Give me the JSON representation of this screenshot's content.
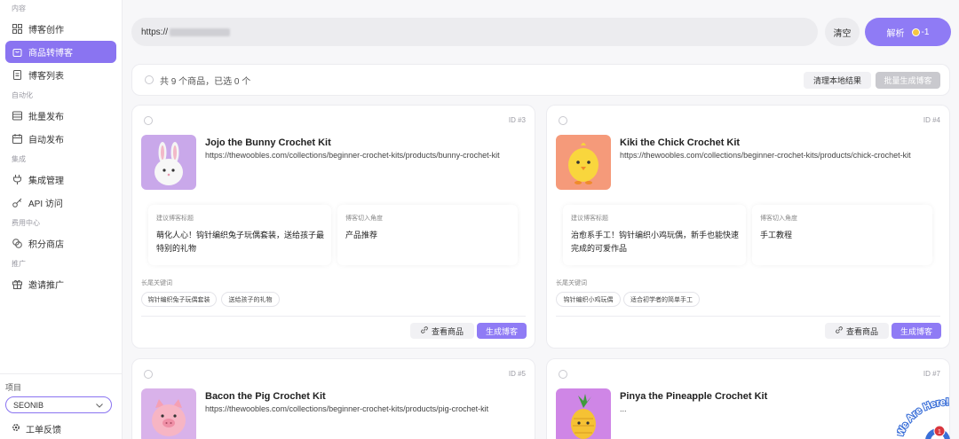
{
  "sidebar": {
    "sections": [
      {
        "label": "内容",
        "items": [
          {
            "label": "博客创作",
            "icon": "grid-icon",
            "active": false
          },
          {
            "label": "商品转博客",
            "icon": "bag-icon",
            "active": true
          },
          {
            "label": "博客列表",
            "icon": "doc-icon",
            "active": false
          }
        ]
      },
      {
        "label": "自动化",
        "items": [
          {
            "label": "批量发布",
            "icon": "stack-icon",
            "active": false
          },
          {
            "label": "自动发布",
            "icon": "calendar-icon",
            "active": false
          }
        ]
      },
      {
        "label": "集成",
        "items": [
          {
            "label": "集成管理",
            "icon": "plug-icon",
            "active": false
          },
          {
            "label": "API 访问",
            "icon": "key-icon",
            "active": false
          }
        ]
      },
      {
        "label": "费用中心",
        "items": [
          {
            "label": "积分商店",
            "icon": "coins-icon",
            "active": false
          }
        ]
      },
      {
        "label": "推广",
        "items": [
          {
            "label": "邀请推广",
            "icon": "gift-icon",
            "active": false
          }
        ]
      }
    ],
    "project_label": "项目",
    "project_value": "SEONIB",
    "feedback_label": "工单反馈"
  },
  "toolbar": {
    "url_prefix": "https://",
    "clear_label": "清空",
    "parse_label": "解析",
    "parse_cost": "-1"
  },
  "status": {
    "text": "共 9 个商品，已选 0 个",
    "clean_label": "清理本地结果",
    "batch_label": "批量生成博客"
  },
  "labels": {
    "suggest_title": "建议博客标题",
    "angle": "博客切入角度",
    "keywords": "长尾关键词",
    "view": "查看商品",
    "generate": "生成博客"
  },
  "products": [
    {
      "id": "ID #3",
      "name": "Jojo the Bunny Crochet Kit",
      "url": "https://thewoobles.com/collections/beginner-crochet-kits/products/bunny-crochet-kit",
      "title_suggest": "萌化人心！钩针编织兔子玩偶套装，送给孩子最特别的礼物",
      "angle": "产品推荐",
      "keywords": [
        "钩针编织兔子玩偶套装",
        "送给孩子的礼物"
      ],
      "thumb_bg": "#c9a8ea"
    },
    {
      "id": "ID #4",
      "name": "Kiki the Chick Crochet Kit",
      "url": "https://thewoobles.com/collections/beginner-crochet-kits/products/chick-crochet-kit",
      "title_suggest": "治愈系手工！钩针编织小鸡玩偶，新手也能快速完成的可爱作品",
      "angle": "手工教程",
      "keywords": [
        "钩针编织小鸡玩偶",
        "适合初学者的简单手工"
      ],
      "thumb_bg": "#f59a7a"
    },
    {
      "id": "ID #5",
      "name": "Bacon the Pig Crochet Kit",
      "url": "https://thewoobles.com/collections/beginner-crochet-kits/products/pig-crochet-kit",
      "thumb_bg": "#d9b2ea"
    },
    {
      "id": "ID #7",
      "name": "Pinya the Pineapple Crochet Kit",
      "url": "...",
      "thumb_bg": "#cf86e6"
    }
  ],
  "badge": {
    "text": "We Are Here!",
    "count": "1"
  }
}
